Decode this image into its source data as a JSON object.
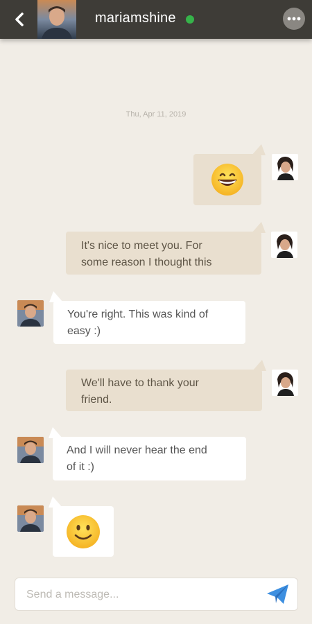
{
  "header": {
    "username": "mariamshine",
    "status": "online",
    "status_color": "#36b34a",
    "back_icon": "chevron-left-icon",
    "more_icon": "more-horizontal-icon"
  },
  "chat": {
    "date": "Thu, Apr 11, 2019",
    "messages": [
      {
        "direction": "outgoing",
        "kind": "emoji",
        "emoji": "grinning-face"
      },
      {
        "direction": "outgoing",
        "kind": "text",
        "lines": [
          "It's nice to meet you.  For",
          "some reason I thought this"
        ]
      },
      {
        "direction": "incoming",
        "kind": "text",
        "lines": [
          "You're right.  This was kind of",
          "easy :)"
        ]
      },
      {
        "direction": "outgoing",
        "kind": "text",
        "lines": [
          "We'll have to thank your",
          "friend."
        ]
      },
      {
        "direction": "incoming",
        "kind": "text",
        "lines": [
          "And I will never hear the end",
          "of it :)"
        ]
      },
      {
        "direction": "incoming",
        "kind": "emoji",
        "emoji": "slightly-smiling-face"
      }
    ]
  },
  "composer": {
    "placeholder": "Send a message...",
    "value": "",
    "send_icon": "paper-plane-icon"
  },
  "colors": {
    "header_bg": "#3e3c37",
    "chat_bg": "#f1ede6",
    "outgoing_bubble": "#e9dfcf",
    "incoming_bubble": "#ffffff",
    "send_accent": "#3d8fe0"
  }
}
